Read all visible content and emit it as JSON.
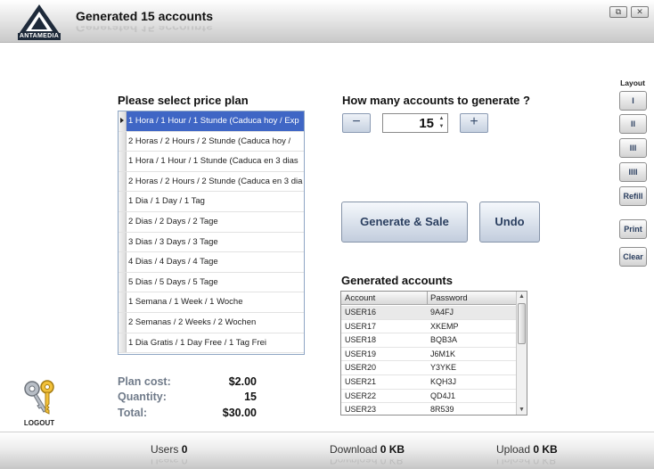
{
  "app": {
    "logo_text": "ANTAMEDIA",
    "title": "Generated 15 accounts",
    "restore_glyph": "⧉",
    "close_glyph": "✕"
  },
  "plans": {
    "heading": "Please select price plan",
    "items": [
      "1 Hora / 1 Hour / 1 Stunde (Caduca hoy / Exp",
      "2 Horas / 2 Hours / 2 Stunde (Caduca hoy /",
      "1 Hora / 1 Hour / 1 Stunde (Caduca en 3 dias",
      "2 Horas / 2 Hours / 2 Stunde (Caduca en 3 dia",
      "1 Dia / 1 Day / 1 Tag",
      "2 Dias / 2 Days / 2 Tage",
      "3 Dias / 3 Days / 3 Tage",
      "4 Dias / 4 Days / 4 Tage",
      "5 Dias / 5 Days / 5 Tage",
      "1 Semana / 1 Week / 1 Woche",
      "2 Semanas / 2 Weeks / 2 Wochen",
      "1 Dia Gratis / 1 Day Free / 1 Tag  Frei"
    ],
    "selected_index": 0
  },
  "generate": {
    "heading": "How many accounts to generate ?",
    "minus_label": "−",
    "plus_label": "+",
    "count": "15",
    "spin_up": "▲",
    "spin_down": "▼",
    "generate_button": "Generate & Sale",
    "undo_button": "Undo"
  },
  "accounts": {
    "heading": "Generated accounts",
    "columns": [
      "Account",
      "Password"
    ],
    "rows": [
      [
        "USER16",
        "9A4FJ"
      ],
      [
        "USER17",
        "XKEMP"
      ],
      [
        "USER18",
        "BQB3A"
      ],
      [
        "USER19",
        "J6M1K"
      ],
      [
        "USER20",
        "Y3YKE"
      ],
      [
        "USER21",
        "KQH3J"
      ],
      [
        "USER22",
        "QD4J1"
      ],
      [
        "USER23",
        "8R539"
      ]
    ],
    "scroll_up": "▲",
    "scroll_down": "▼"
  },
  "summary": {
    "plan_cost_label": "Plan cost:",
    "plan_cost": "$2.00",
    "quantity_label": "Quantity:",
    "quantity": "15",
    "total_label": "Total:",
    "total": "$30.00"
  },
  "sidebar": {
    "layout_label": "Layout",
    "layout_buttons": [
      "I",
      "II",
      "III",
      "IIII"
    ],
    "refill": "Refill",
    "print": "Print",
    "clear": "Clear"
  },
  "logout": {
    "label": "LOGOUT"
  },
  "status": {
    "users_label": "Users",
    "users_value": "0",
    "download_label": "Download",
    "download_value": "0 KB",
    "upload_label": "Upload",
    "upload_value": "0 KB"
  },
  "colors": {
    "selection": "#3f66c5",
    "button_text": "#2b3f60",
    "summary_label": "#707b8a"
  }
}
